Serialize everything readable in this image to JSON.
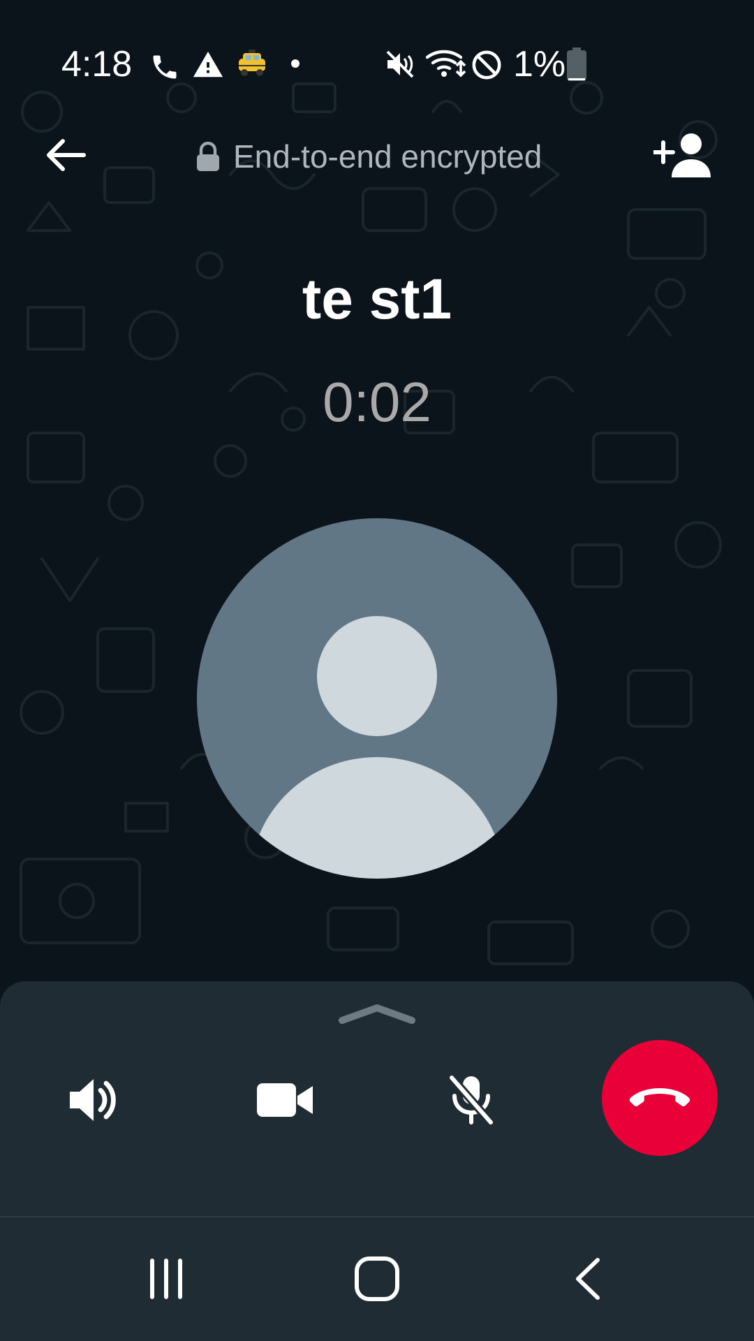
{
  "status_bar": {
    "time": "4:18",
    "battery_percent": "1%",
    "icons": [
      "phone-icon",
      "warning-icon",
      "taxi-icon",
      "dot-icon",
      "mute-icon",
      "wifi-icon",
      "do-not-disturb-icon",
      "battery-icon"
    ],
    "battery_level": 0.01
  },
  "header": {
    "encrypted_label": "End-to-end encrypted",
    "back_icon": "arrow-left-icon",
    "lock_icon": "lock-icon",
    "add_person_icon": "add-person-icon"
  },
  "call": {
    "contact_name": "te st1",
    "duration": "0:02",
    "avatar_icon": "default-avatar-icon"
  },
  "controls": {
    "handle_icon": "chevron-up-icon",
    "speaker_icon": "speaker-icon",
    "video_icon": "video-camera-icon",
    "mic_icon": "mic-off-icon",
    "end_call_icon": "end-call-icon"
  },
  "nav_bar": {
    "recents_icon": "recents-icon",
    "home_icon": "home-icon",
    "back_icon": "nav-back-icon"
  },
  "colors": {
    "background": "#0b141a",
    "panel": "#1f2c34",
    "end_call": "#ea0038",
    "avatar_bg": "#627785",
    "avatar_fg": "#cfd8dd",
    "muted_text": "#b0b7bb",
    "timer_text": "#a9a9a9"
  }
}
